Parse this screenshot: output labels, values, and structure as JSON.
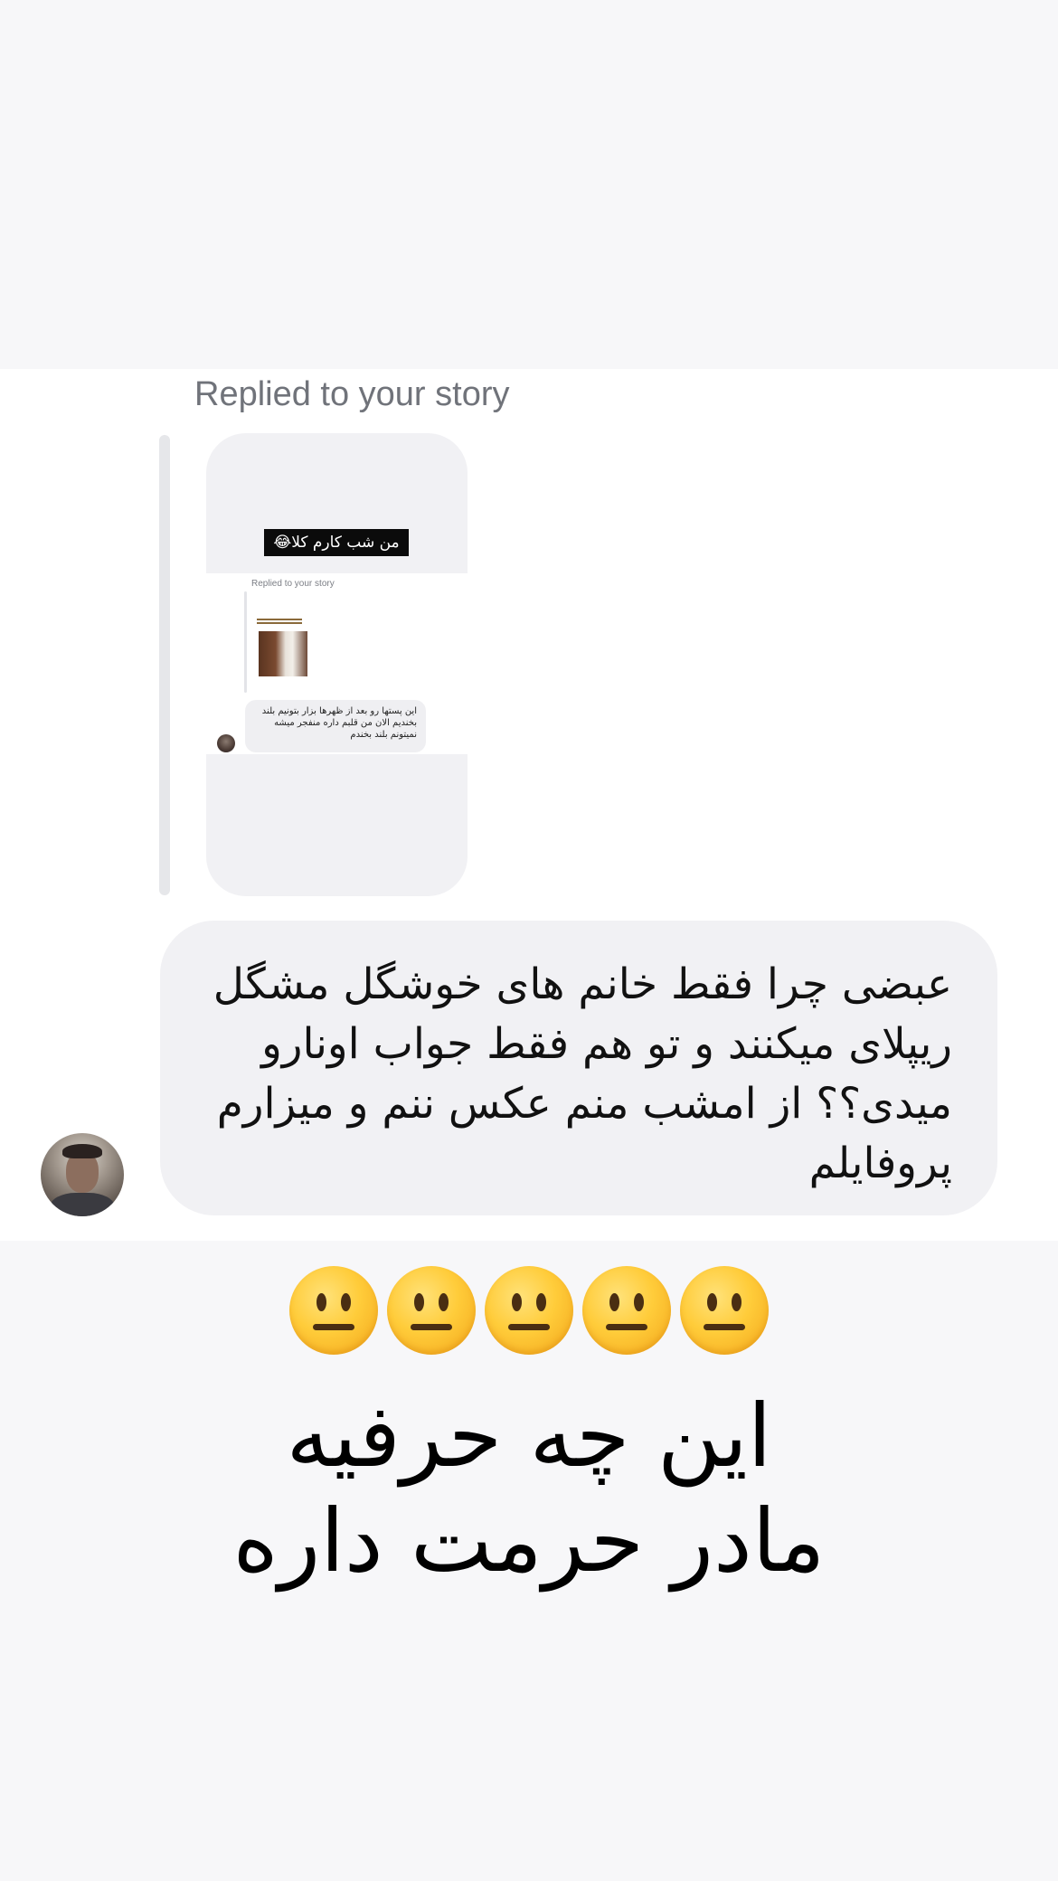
{
  "thread": {
    "reply_label": "Replied to your story",
    "story_preview": {
      "caption": "من شب کارم کلا😂",
      "nested_reply_label": "Replied to your story",
      "nested_message": "این پستها رو بعد از ظهرها بزار بتونیم بلند\nبخندیم الان من قلبم داره منفجر میشه\nنمیتونم بلند بخندم"
    },
    "message": {
      "text": "عبضی چرا فقط خانم های خوشگل مشگل\nریپلای میکنند و تو هم فقط جواب اونارو\nمیدی؟؟ از امشب منم عکس ننم و میزارم\nپروفایلم"
    }
  },
  "overlay": {
    "emoji_icons": [
      "neutral-face-icon",
      "neutral-face-icon",
      "neutral-face-icon",
      "neutral-face-icon",
      "neutral-face-icon"
    ],
    "caption": "این چه حرفیه\nمادر حرمت داره"
  },
  "colors": {
    "page_background": "#f7f7f9",
    "chat_background": "#ffffff",
    "bubble_background": "#f1f1f4",
    "secondary_text": "#70737a"
  }
}
